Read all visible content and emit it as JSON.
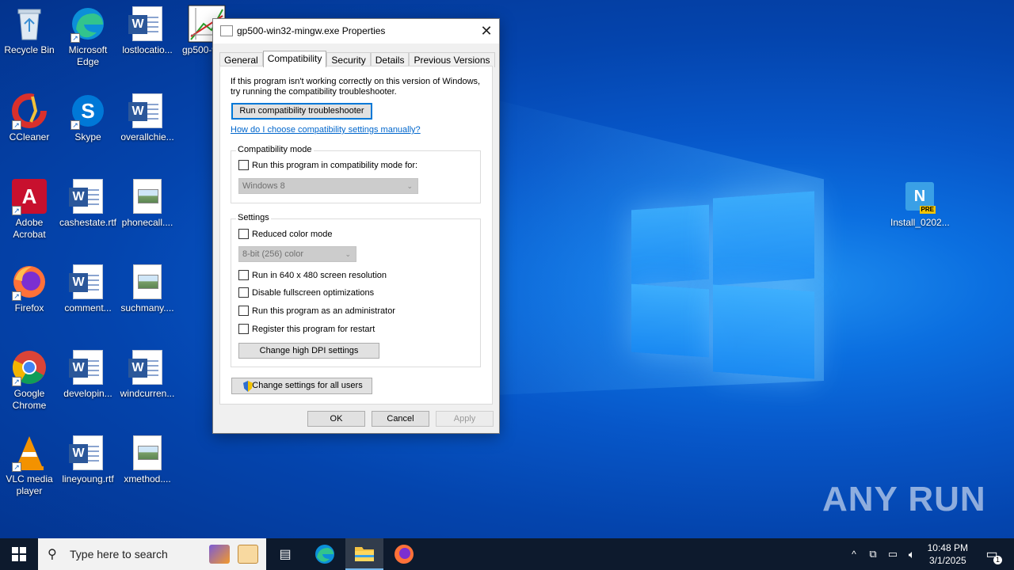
{
  "desktop": {
    "icons": [
      {
        "label": "Recycle Bin"
      },
      {
        "label": "Microsoft Edge"
      },
      {
        "label": "lostlocatio..."
      },
      {
        "label": "gp500-w"
      },
      {
        "label": "CCleaner"
      },
      {
        "label": "Skype"
      },
      {
        "label": "overallchie..."
      },
      {
        "label": "Adobe Acrobat"
      },
      {
        "label": "cashestate.rtf"
      },
      {
        "label": "phonecall...."
      },
      {
        "label": "Firefox"
      },
      {
        "label": "comment..."
      },
      {
        "label": "suchmany...."
      },
      {
        "label": "Google Chrome"
      },
      {
        "label": "developin..."
      },
      {
        "label": "windcurren..."
      },
      {
        "label": "VLC media player"
      },
      {
        "label": "lineyoung.rtf"
      },
      {
        "label": "xmethod...."
      },
      {
        "label": "Install_0202..."
      }
    ],
    "install_badge": "PRE",
    "watermark": "ANY RUN"
  },
  "dialog": {
    "title": "gp500-win32-mingw.exe Properties",
    "tabs": [
      "General",
      "Compatibility",
      "Security",
      "Details",
      "Previous Versions"
    ],
    "intro": "If this program isn't working correctly on this version of Windows, try running the compatibility troubleshooter.",
    "troubleshooter_btn": "Run compatibility troubleshooter",
    "manual_link": "How do I choose compatibility settings manually?",
    "compat_group": "Compatibility mode",
    "compat_checkbox": "Run this program in compatibility mode for:",
    "compat_select": "Windows 8",
    "settings_group": "Settings",
    "reduced_color": "Reduced color mode",
    "color_select": "8-bit (256) color",
    "res_640": "Run in 640 x 480 screen resolution",
    "disable_fullscreen": "Disable fullscreen optimizations",
    "run_admin": "Run this program as an administrator",
    "register_restart": "Register this program for restart",
    "dpi_btn": "Change high DPI settings",
    "all_users_btn": "Change settings for all users",
    "ok": "OK",
    "cancel": "Cancel",
    "apply": "Apply"
  },
  "taskbar": {
    "search_placeholder": "Type here to search",
    "time": "10:48 PM",
    "date": "3/1/2025",
    "notifications": "1"
  }
}
